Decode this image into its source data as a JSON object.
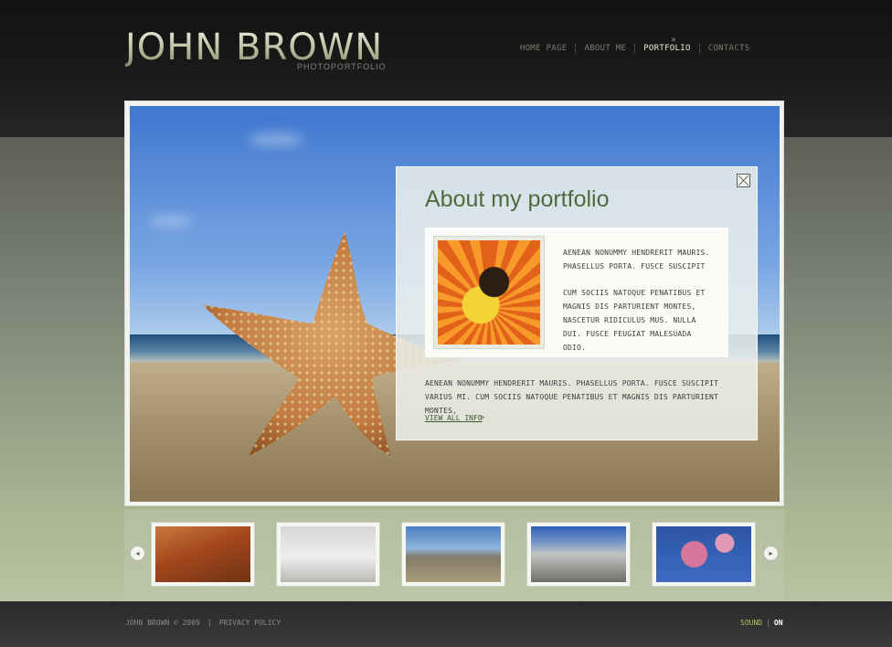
{
  "logo": {
    "name": "JOHN BROWN",
    "subtitle": "PHOTOPORTFOLIO"
  },
  "nav": {
    "items": [
      {
        "label": "HOME PAGE",
        "active": false
      },
      {
        "label": "ABOUT ME",
        "active": false
      },
      {
        "label": "PORTFOLIO",
        "active": true
      },
      {
        "label": "CONTACTS",
        "active": false
      }
    ]
  },
  "about": {
    "title": "About my portfolio",
    "text_para1": "AENEAN NONUMMY HENDRERIT MAURIS. PHASELLUS PORTA. FUSCE SUSCIPIT",
    "text_para2": "CUM SOCIIS NATOQUE PENATIBUS ET MAGNIS DIS PARTURIENT MONTES, NASCETUR RIDICULUS MUS. NULLA DUI. FUSCE FEUGIAT MALESUADA ODIO.",
    "description": "AENEAN NONUMMY HENDRERIT MAURIS. PHASELLUS PORTA. FUSCE SUSCIPIT VARIUS MI. CUM SOCIIS NATOQUE PENATIBUS ET MAGNIS DIS PARTURIENT MONTES,",
    "view_all": "VIEW ALL INFO",
    "view_all_arrow": "»"
  },
  "gallery": {
    "prev_icon": "◂",
    "next_icon": "▸"
  },
  "footer": {
    "copyright": "JOHN BROWN © 2009",
    "divider": "|",
    "privacy": "PRIVACY POLICY",
    "sound_label": "SOUND",
    "sound_divider": "|",
    "sound_state": "ON"
  },
  "colors": {
    "accent": "#a7c861",
    "title_green": "#4e6b3e"
  }
}
